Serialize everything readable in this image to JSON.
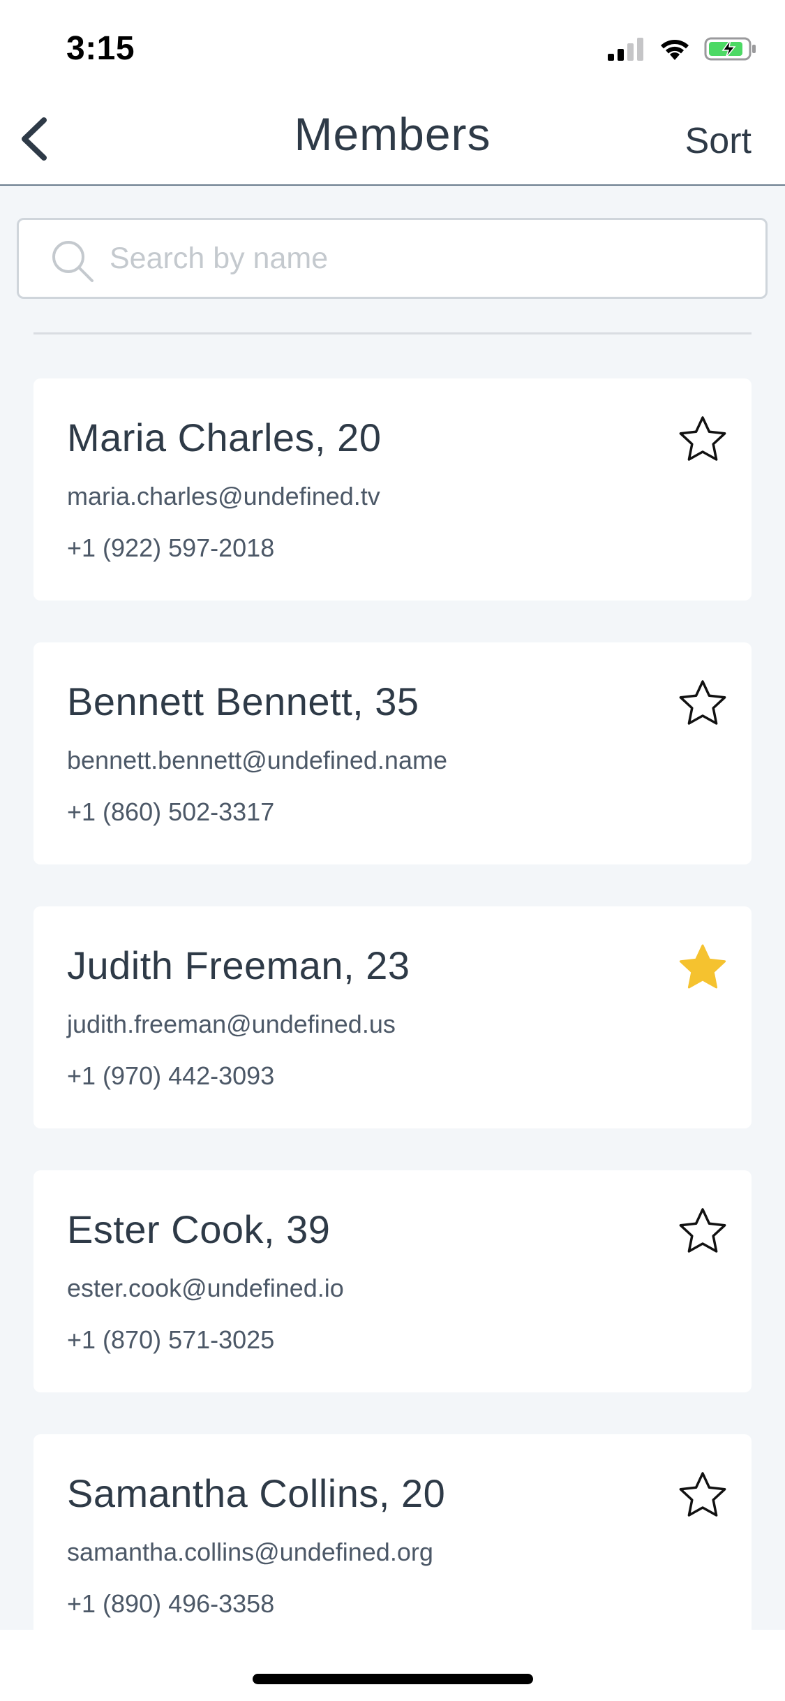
{
  "status_bar": {
    "time": "3:15"
  },
  "nav": {
    "title": "Members",
    "sort_label": "Sort"
  },
  "search": {
    "placeholder": "Search by name",
    "value": ""
  },
  "members": [
    {
      "name": "Maria Charles, 20",
      "email": "maria.charles@undefined.tv",
      "phone": "+1 (922) 597-2018",
      "favorite": false
    },
    {
      "name": "Bennett Bennett, 35",
      "email": "bennett.bennett@undefined.name",
      "phone": "+1 (860) 502-3317",
      "favorite": false
    },
    {
      "name": "Judith Freeman, 23",
      "email": "judith.freeman@undefined.us",
      "phone": "+1 (970) 442-3093",
      "favorite": true
    },
    {
      "name": "Ester Cook, 39",
      "email": "ester.cook@undefined.io",
      "phone": "+1 (870) 571-3025",
      "favorite": false
    },
    {
      "name": "Samantha Collins, 20",
      "email": "samantha.collins@undefined.org",
      "phone": "+1 (890) 496-3358",
      "favorite": false
    }
  ],
  "colors": {
    "favorite_star": "#f5c22f",
    "text_primary": "#2e3a47",
    "background": "#f3f6f9"
  },
  "icons": {
    "back": "chevron-left-icon",
    "search": "search-icon",
    "star_empty": "star-outline-icon",
    "star_filled": "star-filled-icon"
  }
}
